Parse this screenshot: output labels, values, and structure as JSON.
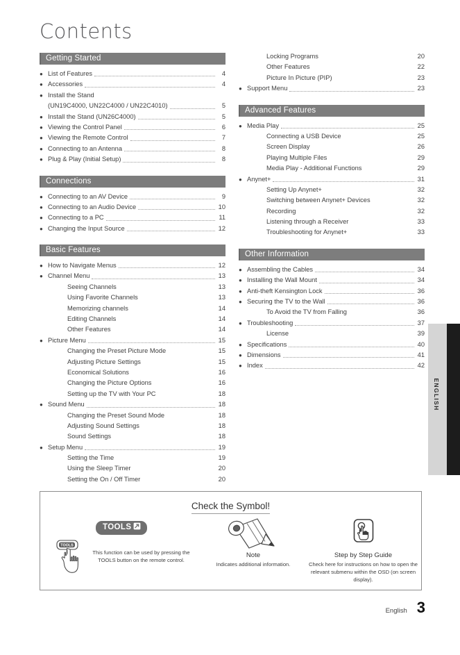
{
  "page_title": "Contents",
  "footer": {
    "language": "English",
    "page_number": "3"
  },
  "side_tab": {
    "label": "ENGLISH"
  },
  "colors": {
    "section_bar": "#7d7d7d",
    "section_bar_text": "#ffffff",
    "tools_badge": "#6f6f6f",
    "side_tab_grey": "#d5d5d5",
    "side_tab_black": "#1c1c1c"
  },
  "left_column": [
    {
      "heading": "Getting Started",
      "items": [
        {
          "level": 1,
          "label": "List of Features",
          "page": "4",
          "leader": true
        },
        {
          "level": 1,
          "label": "Accessories",
          "page": "4",
          "leader": true
        },
        {
          "level": 1,
          "label": "Install the Stand",
          "page": "",
          "leader": false
        },
        {
          "level": 1,
          "cont": true,
          "label": "(UN19C4000, UN22C4000 / UN22C4010)",
          "page": "5",
          "leader": true
        },
        {
          "level": 1,
          "label": "Install the Stand (UN26C4000)",
          "page": "5",
          "leader": true
        },
        {
          "level": 1,
          "label": "Viewing the Control Panel",
          "page": "6",
          "leader": true
        },
        {
          "level": 1,
          "label": "Viewing the Remote Control",
          "page": "7",
          "leader": true
        },
        {
          "level": 1,
          "label": "Connecting to an Antenna",
          "page": "8",
          "leader": true
        },
        {
          "level": 1,
          "label": "Plug & Play (Initial Setup)",
          "page": "8",
          "leader": true
        }
      ]
    },
    {
      "heading": "Connections",
      "items": [
        {
          "level": 1,
          "label": "Connecting to an AV Device",
          "page": "9",
          "leader": true
        },
        {
          "level": 1,
          "label": "Connecting to an Audio Device",
          "page": "10",
          "leader": true
        },
        {
          "level": 1,
          "label": "Connecting to a PC",
          "page": "11",
          "leader": true
        },
        {
          "level": 1,
          "label": "Changing the Input Source",
          "page": "12",
          "leader": true
        }
      ]
    },
    {
      "heading": "Basic Features",
      "items": [
        {
          "level": 1,
          "label": "How to Navigate Menus",
          "page": "12",
          "leader": true
        },
        {
          "level": 1,
          "label": "Channel Menu",
          "page": "13",
          "leader": true
        },
        {
          "level": 2,
          "label": "Seeing Channels",
          "page": "13",
          "leader": false
        },
        {
          "level": 2,
          "label": "Using Favorite Channels",
          "page": "13",
          "leader": false
        },
        {
          "level": 2,
          "label": "Memorizing channels",
          "page": "14",
          "leader": false
        },
        {
          "level": 2,
          "label": "Editing Channels",
          "page": "14",
          "leader": false
        },
        {
          "level": 2,
          "label": "Other Features",
          "page": "14",
          "leader": false
        },
        {
          "level": 1,
          "label": "Picture Menu",
          "page": "15",
          "leader": true
        },
        {
          "level": 2,
          "label": "Changing the Preset Picture Mode",
          "page": "15",
          "leader": false
        },
        {
          "level": 2,
          "label": "Adjusting Picture Settings",
          "page": "15",
          "leader": false
        },
        {
          "level": 2,
          "label": "Economical Solutions",
          "page": "16",
          "leader": false
        },
        {
          "level": 2,
          "label": "Changing the Picture Options",
          "page": "16",
          "leader": false
        },
        {
          "level": 2,
          "label": "Setting up the TV with Your PC",
          "page": "18",
          "leader": false
        },
        {
          "level": 1,
          "label": "Sound Menu",
          "page": "18",
          "leader": true
        },
        {
          "level": 2,
          "label": "Changing the Preset Sound Mode",
          "page": "18",
          "leader": false
        },
        {
          "level": 2,
          "label": "Adjusting Sound Settings",
          "page": "18",
          "leader": false
        },
        {
          "level": 2,
          "label": "Sound Settings",
          "page": "18",
          "leader": false
        },
        {
          "level": 1,
          "label": "Setup Menu",
          "page": "19",
          "leader": true
        },
        {
          "level": 2,
          "label": "Setting the Time",
          "page": "19",
          "leader": false
        },
        {
          "level": 2,
          "label": "Using the Sleep Timer",
          "page": "20",
          "leader": false
        },
        {
          "level": 2,
          "label": "Setting the On / Off Timer",
          "page": "20",
          "leader": false
        }
      ]
    }
  ],
  "right_column": [
    {
      "heading": "",
      "items": [
        {
          "level": 2,
          "label": "Locking Programs",
          "page": "20",
          "leader": false
        },
        {
          "level": 2,
          "label": "Other Features",
          "page": "22",
          "leader": false
        },
        {
          "level": 2,
          "label": "Picture In Picture (PIP)",
          "page": "23",
          "leader": false
        },
        {
          "level": 1,
          "label": "Support Menu",
          "page": "23",
          "leader": true
        }
      ]
    },
    {
      "heading": "Advanced Features",
      "items": [
        {
          "level": 1,
          "label": "Media Play",
          "page": "25",
          "leader": true
        },
        {
          "level": 2,
          "label": "Connecting a USB Device",
          "page": "25",
          "leader": false
        },
        {
          "level": 2,
          "label": "Screen Display",
          "page": "26",
          "leader": false
        },
        {
          "level": 2,
          "label": "Playing Multiple Files",
          "page": "29",
          "leader": false
        },
        {
          "level": 2,
          "label": "Media Play - Additional Functions",
          "page": "29",
          "leader": false
        },
        {
          "level": 1,
          "label": "Anynet+",
          "page": "31",
          "leader": true
        },
        {
          "level": 2,
          "label": "Setting Up Anynet+",
          "page": "32",
          "leader": false
        },
        {
          "level": 2,
          "label": "Switching between Anynet+ Devices",
          "page": "32",
          "leader": false
        },
        {
          "level": 2,
          "label": "Recording",
          "page": "32",
          "leader": false
        },
        {
          "level": 2,
          "label": "Listening through a Receiver",
          "page": "33",
          "leader": false
        },
        {
          "level": 2,
          "label": "Troubleshooting for Anynet+",
          "page": "33",
          "leader": false
        }
      ]
    },
    {
      "heading": "Other Information",
      "items": [
        {
          "level": 1,
          "label": "Assembling the Cables",
          "page": "34",
          "leader": true
        },
        {
          "level": 1,
          "label": "Installing the Wall Mount",
          "page": "34",
          "leader": true
        },
        {
          "level": 1,
          "label": "Anti-theft Kensington Lock",
          "page": "36",
          "leader": true
        },
        {
          "level": 1,
          "label": "Securing the TV to the Wall",
          "page": "36",
          "leader": true
        },
        {
          "level": 2,
          "label": "To Avoid the TV from Falling",
          "page": "36",
          "leader": false
        },
        {
          "level": 1,
          "label": "Troubleshooting",
          "page": "37",
          "leader": true
        },
        {
          "level": 2,
          "label": "License",
          "page": "39",
          "leader": false
        },
        {
          "level": 1,
          "label": "Specifications",
          "page": "40",
          "leader": true
        },
        {
          "level": 1,
          "label": "Dimensions",
          "page": "41",
          "leader": true
        },
        {
          "level": 1,
          "label": "Index",
          "page": "42",
          "leader": true
        }
      ]
    }
  ],
  "symbol_box": {
    "title": "Check the Symbol!",
    "tools_badge_label": "TOOLS",
    "tools_badge_icon": "arrow-in-box-icon",
    "remote_button_label": "TOOLS",
    "col1_text": "This function can be used by pressing the TOOLS button on the remote control.",
    "col2_icon": "pencil-icon",
    "col2_heading": "Note",
    "col2_text": "Indicates additional information.",
    "col3_icon": "press-button-hand-icon",
    "col3_heading": "Step by Step Guide",
    "col3_text": "Check here for instructions on how to open the relevant submenu within the OSD (on screen display)."
  }
}
